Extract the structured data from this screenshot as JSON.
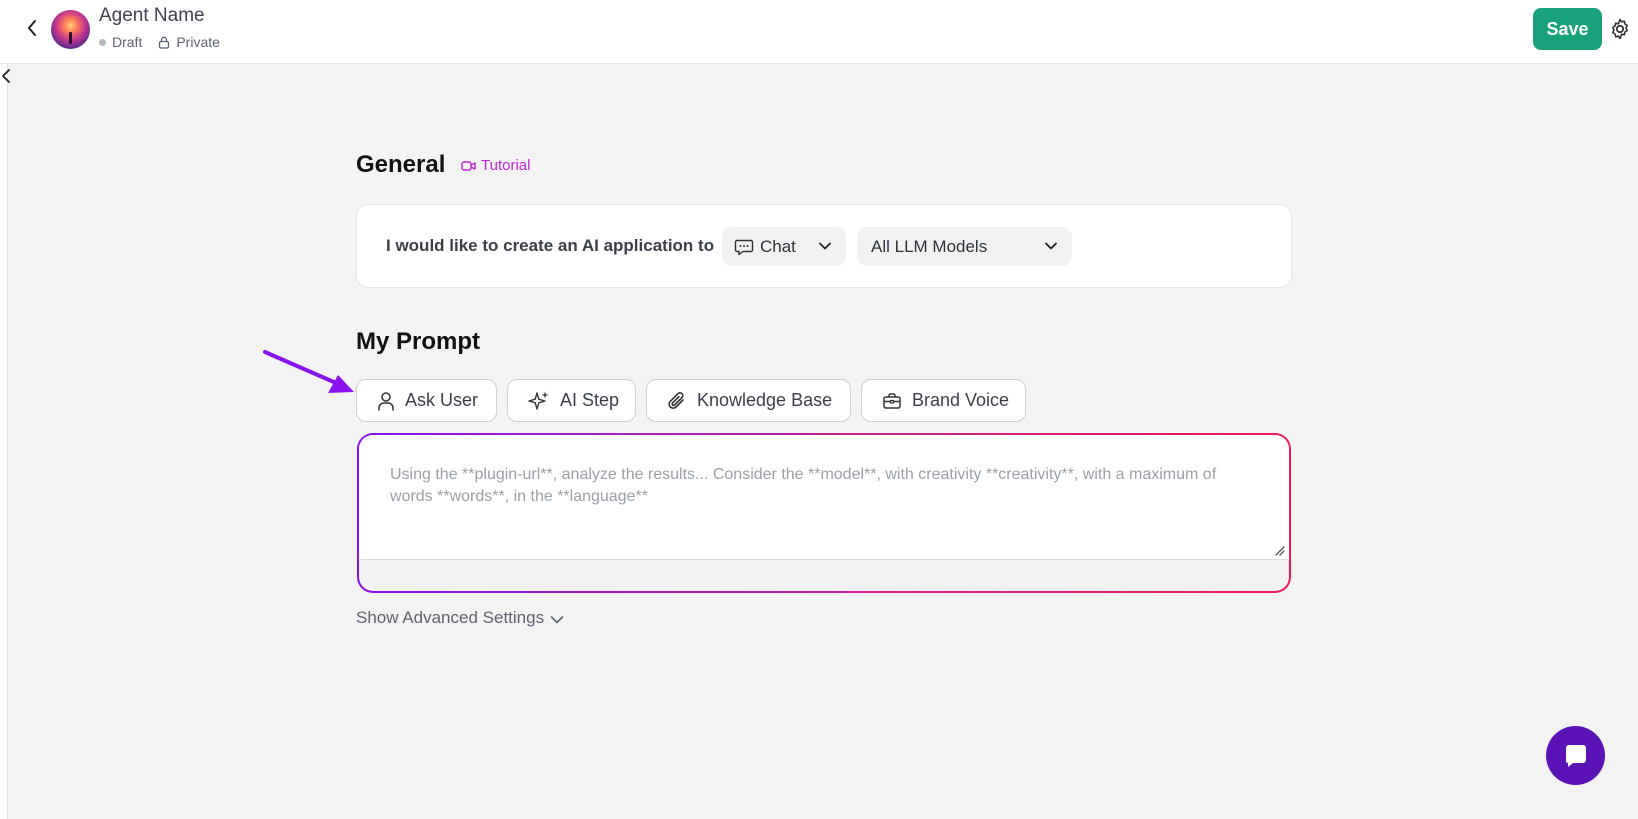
{
  "header": {
    "agent_name": "Agent Name",
    "status": "Draft",
    "visibility": "Private",
    "save_label": "Save"
  },
  "general": {
    "title": "General",
    "tutorial_label": "Tutorial",
    "sentence": "I would like to create an AI application to",
    "app_type_selected": "Chat",
    "model_selected": "All LLM Models"
  },
  "prompt": {
    "title": "My Prompt",
    "tools": [
      {
        "label": "Ask User",
        "icon": "user-icon"
      },
      {
        "label": "AI Step",
        "icon": "sparkles-icon"
      },
      {
        "label": "Knowledge Base",
        "icon": "paperclip-icon"
      },
      {
        "label": "Brand Voice",
        "icon": "briefcase-icon"
      }
    ],
    "placeholder": "Using the **plugin-url**, analyze the results... Consider the **model**, with creativity **creativity**, with a maximum of words **words**, in the **language**",
    "value": ""
  },
  "advanced_label": "Show Advanced Settings",
  "colors": {
    "save": "#17a27b",
    "tutorial": "#c026d3",
    "gradient_start": "#8b12f0",
    "gradient_end": "#f0195a",
    "fab": "#5b13b8",
    "annotation_arrow": "#8b12f0"
  }
}
